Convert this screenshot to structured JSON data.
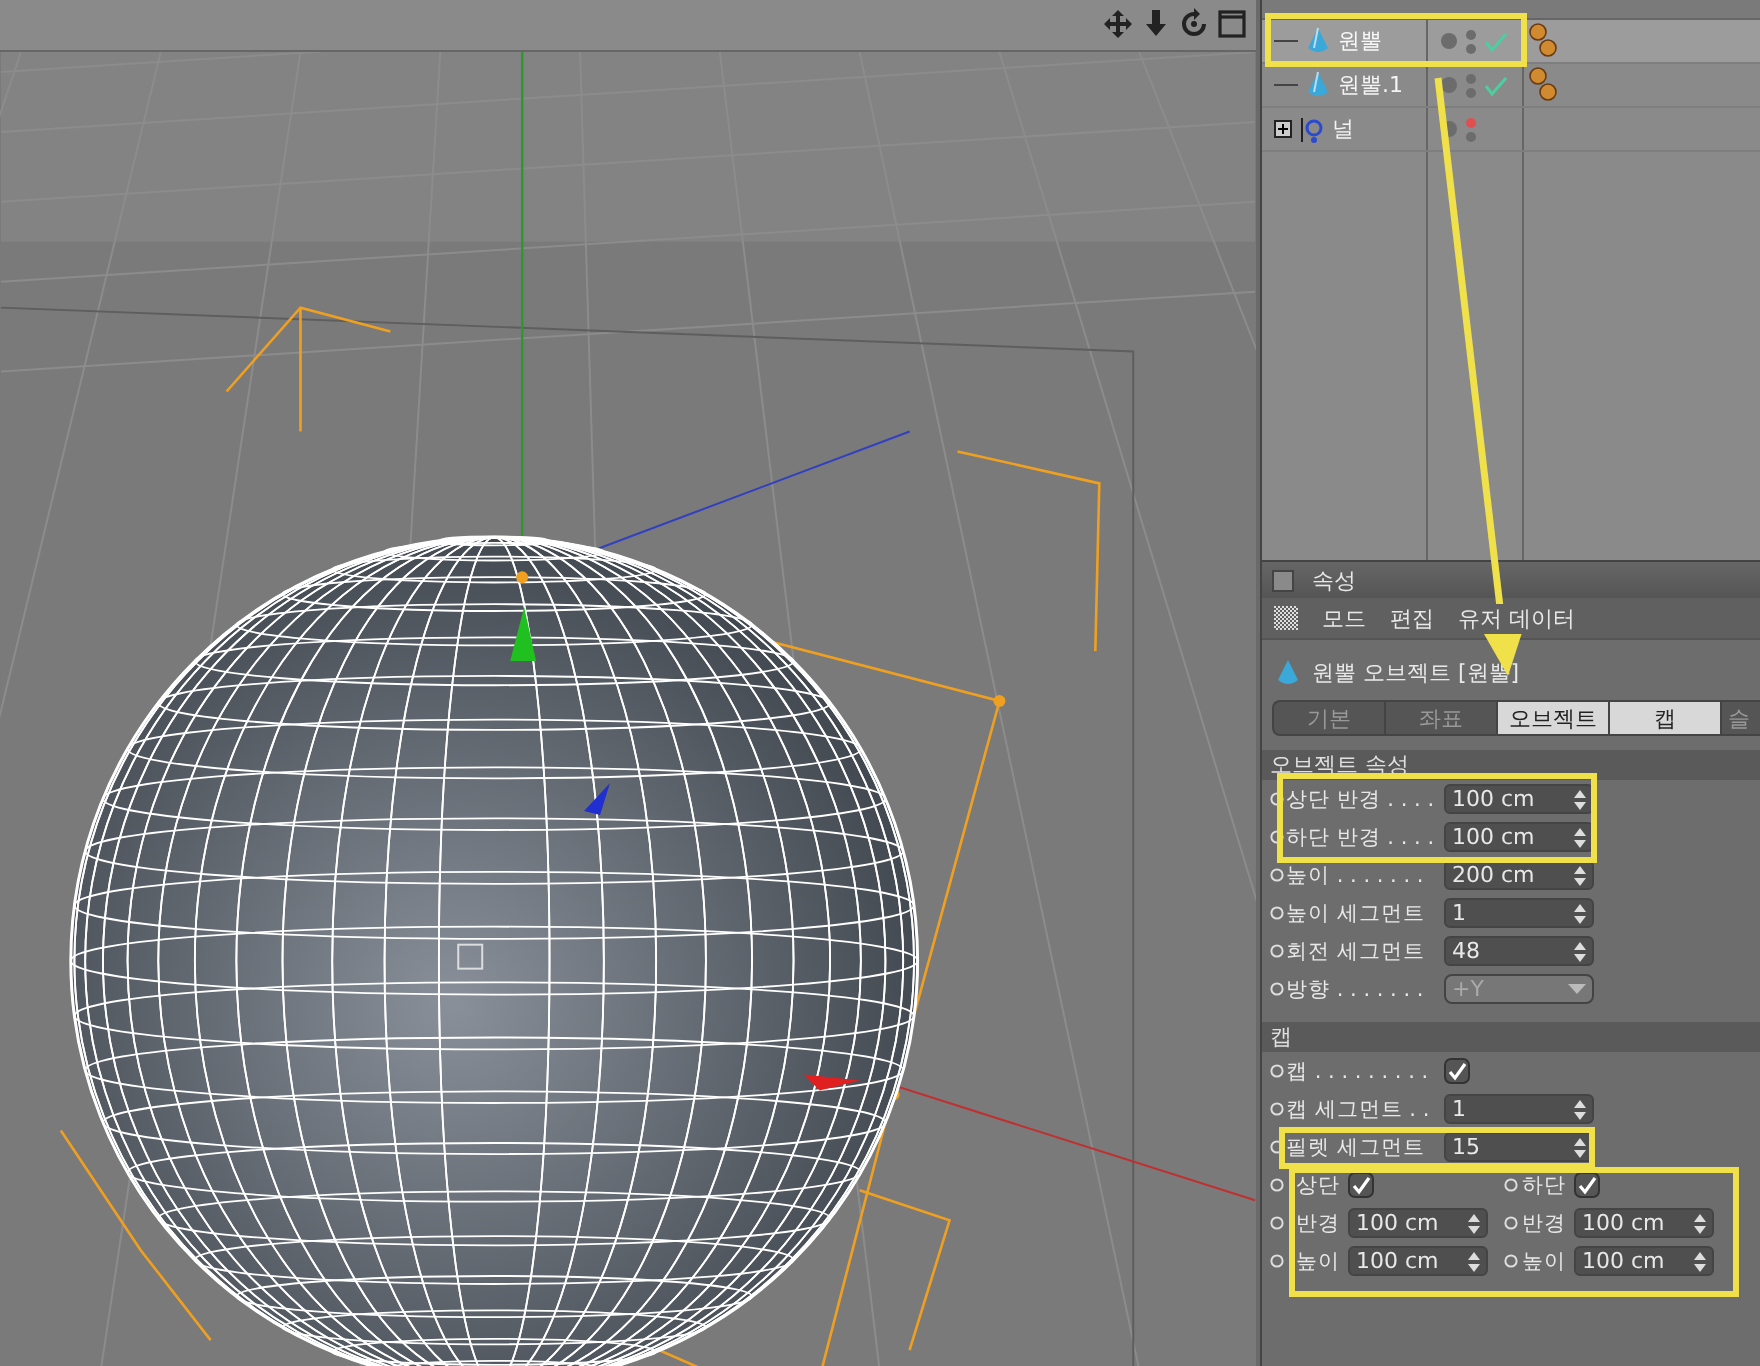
{
  "object_manager": {
    "rows": [
      {
        "name": "원뿔",
        "kind": "cone",
        "selected": true
      },
      {
        "name": "원뿔.1",
        "kind": "cone",
        "selected": false
      },
      {
        "name": "널",
        "kind": "null",
        "selected": false,
        "expanded": false
      }
    ]
  },
  "attributes": {
    "title": "속성",
    "menu": [
      "모드",
      "편집",
      "유저 데이터"
    ],
    "object_title": "원뿔 오브젝트 [원뿔]",
    "tabs": [
      {
        "label": "기본",
        "selected": false
      },
      {
        "label": "좌표",
        "selected": false
      },
      {
        "label": "오브젝트",
        "selected": true
      },
      {
        "label": "캡",
        "selected": true
      },
      {
        "label": "슬",
        "selected": false
      }
    ],
    "sections": [
      {
        "title": "오브젝트 속성",
        "rows": [
          {
            "kind": "number",
            "label": "상단 반경 . . . .",
            "value": "100 cm"
          },
          {
            "kind": "number",
            "label": "하단 반경 . . . .",
            "value": "100 cm"
          },
          {
            "kind": "number",
            "label": "높이 . . . . . . .",
            "value": "200 cm"
          },
          {
            "kind": "number",
            "label": "높이 세그먼트",
            "value": "1"
          },
          {
            "kind": "number",
            "label": "회전 세그먼트",
            "value": "48"
          },
          {
            "kind": "dropdown",
            "label": "방향 . . . . . . .",
            "value": "+Y",
            "disabled": true
          }
        ]
      },
      {
        "title": "캡",
        "rows": [
          {
            "kind": "checkbox",
            "label": "캡 . . . . . . . . .",
            "checked": true
          },
          {
            "kind": "number",
            "label": "캡 세그먼트 . .",
            "value": "1"
          },
          {
            "kind": "number",
            "label": "필렛 세그먼트",
            "value": "15"
          },
          {
            "kind": "pair",
            "items": [
              {
                "kind": "checkbox",
                "label": "상단",
                "checked": true
              },
              {
                "kind": "checkbox",
                "label": "하단",
                "checked": true
              }
            ]
          },
          {
            "kind": "pair",
            "items": [
              {
                "kind": "number",
                "label": "반경",
                "value": "100 cm"
              },
              {
                "kind": "number",
                "label": "반경",
                "value": "100 cm"
              }
            ]
          },
          {
            "kind": "pair",
            "items": [
              {
                "kind": "number",
                "label": "높이",
                "value": "100 cm"
              },
              {
                "kind": "number",
                "label": "높이",
                "value": "100 cm"
              }
            ]
          }
        ]
      }
    ]
  }
}
